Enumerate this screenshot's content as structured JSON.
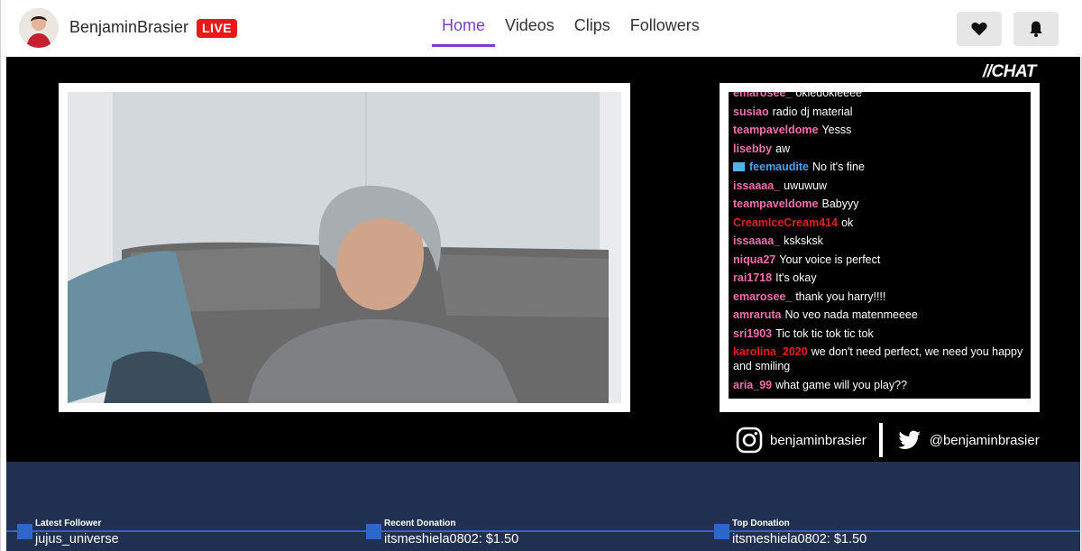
{
  "header": {
    "channel_name": "BenjaminBrasier",
    "live_label": "LIVE",
    "nav": [
      {
        "label": "Home",
        "active": true
      },
      {
        "label": "Videos",
        "active": false
      },
      {
        "label": "Clips",
        "active": false
      },
      {
        "label": "Followers",
        "active": false
      }
    ],
    "follow_icon": "heart-icon",
    "notify_icon": "bell-icon"
  },
  "stream": {
    "chat_title": "//CHAT",
    "chat_messages": [
      {
        "user": "emarosee_",
        "text": "okiedokieeee",
        "color": "#f06fb0"
      },
      {
        "user": "susiao",
        "text": "radio dj material",
        "color": "#f06fb0"
      },
      {
        "user": "teampaveldome",
        "text": "Yesss",
        "color": "#f06fb0"
      },
      {
        "user": "lisebby",
        "text": "aw",
        "color": "#f06fb0"
      },
      {
        "user": "feemaudite",
        "text": "No it's fine",
        "color": "#4aa3ef",
        "badge": true
      },
      {
        "user": "issaaaa_",
        "text": "uwuwuw",
        "color": "#f06fb0"
      },
      {
        "user": "teampaveldome",
        "text": "Babyyy",
        "color": "#f06fb0"
      },
      {
        "user": "CreamIceCream414",
        "text": "ok",
        "color": "#e51e1e"
      },
      {
        "user": "issaaaa_",
        "text": "ksksksk",
        "color": "#f06fb0"
      },
      {
        "user": "niqua27",
        "text": "Your voice is perfect",
        "color": "#f06fb0"
      },
      {
        "user": "rai1718",
        "text": "It's okay",
        "color": "#f06fb0"
      },
      {
        "user": "emarosee_",
        "text": "thank you harry!!!!",
        "color": "#f06fb0"
      },
      {
        "user": "amraruta",
        "text": "No veo nada matenmeeee",
        "color": "#f06fb0"
      },
      {
        "user": "sri1903",
        "text": "Tic tok tic tok tic tok",
        "color": "#f06fb0"
      },
      {
        "user": "karolina_2020",
        "text": "we don't need perfect, we need you happy and smiling",
        "color": "#e51e1e"
      },
      {
        "user": "aria_99",
        "text": "what game will you play??",
        "color": "#f06fb0"
      }
    ],
    "instagram_handle": "benjaminbrasier",
    "twitter_handle": "@benjaminbrasier"
  },
  "bottom_bar": {
    "latest_follower": {
      "label": "Latest Follower",
      "value": "jujus_universe"
    },
    "recent_donation": {
      "label": "Recent Donation",
      "value": "itsmeshiela0802: $1.50"
    },
    "top_donation": {
      "label": "Top Donation",
      "value": "itsmeshiela0802: $1.50"
    }
  },
  "colors": {
    "accent": "#7a3fc8",
    "live": "#e91916",
    "bottom_bg": "#1f3050",
    "bottom_accent": "#2f66c9"
  }
}
